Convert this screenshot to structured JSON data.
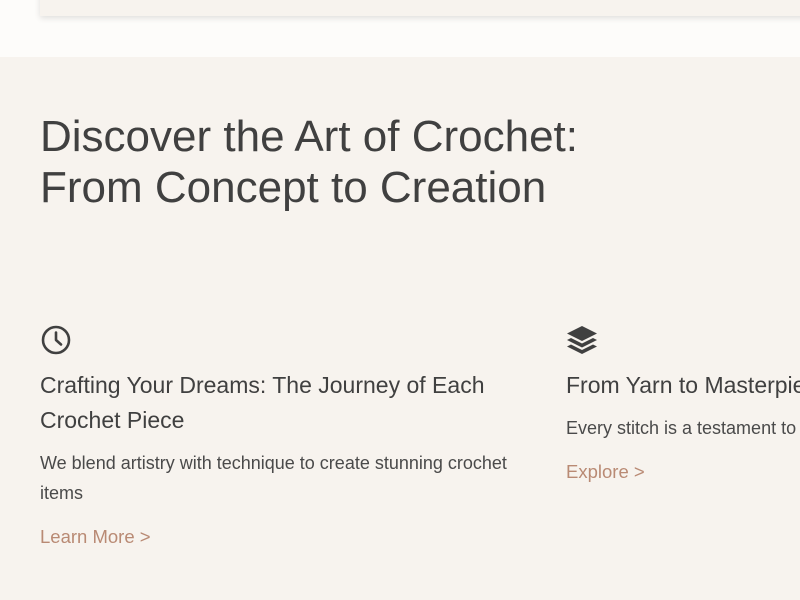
{
  "section": {
    "headline": "Discover the Art of Crochet:\nFrom Concept to Creation"
  },
  "features": [
    {
      "icon": "clock-icon",
      "title": "Crafting Your Dreams: The Journey of Each Crochet Piece",
      "description": "We blend artistry with technique to create stunning crochet items",
      "link": "Learn More >"
    },
    {
      "icon": "layers-icon",
      "title": "From Yarn to Masterpiece: Our Creation Process",
      "description": "Every stitch is a testament to our craftsmanship",
      "link": "Explore >"
    }
  ],
  "colors": {
    "background": "#f7f3ee",
    "top_band": "#fdfcfa",
    "text": "#404040",
    "link": "#b98a74"
  }
}
